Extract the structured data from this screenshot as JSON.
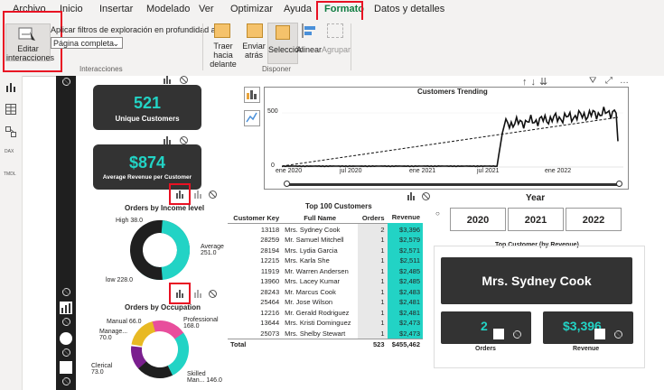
{
  "tabs": [
    "Archivo",
    "Inicio",
    "Insertar",
    "Modelado",
    "Ver",
    "Optimizar",
    "Ayuda",
    "Formato",
    "Datos y detalles"
  ],
  "ribbon": {
    "edit_interactions": "Editar interacciones",
    "drill_filters_label": "Aplicar filtros de exploración en profundidad a",
    "drill_select_value": "Página completa",
    "group_interactions": "Interacciones",
    "bring_forward": "Traer hacia delante",
    "send_backward": "Enviar atrás",
    "selection": "Selección",
    "align": "Alinear",
    "group": "Agrupar",
    "group_arrange": "Disponer"
  },
  "cards": {
    "unique_customers_value": "521",
    "unique_customers_label": "Unique Customers",
    "avg_revenue_value": "$874",
    "avg_revenue_label": "Average Revenue per Customer",
    "top_customer_title": "Top Customer (by Revenue)",
    "top_customer_name": "Mrs. Sydney Cook",
    "orders_value": "2",
    "orders_label": "Orders",
    "revenue_value": "$3,396",
    "revenue_label": "Revenue"
  },
  "trend": {
    "title": "Customers Trending",
    "yticks": [
      "500",
      "0"
    ],
    "xticks": [
      "ene 2020",
      "jul 2020",
      "ene 2021",
      "jul 2021",
      "ene 2022"
    ]
  },
  "donut_income": {
    "title": "Orders by Income level",
    "labels": [
      "High 38.0",
      "Average 251.0",
      "low 228.0"
    ]
  },
  "donut_occupation": {
    "title": "Orders by Occupation",
    "labels": [
      "Manual 66.0",
      "Manage... 70.0",
      "Professional 168.0",
      "Clerical 73.0",
      "Skilled Man... 146.0"
    ]
  },
  "table": {
    "title": "Top 100 Customers",
    "headers": [
      "Customer Key",
      "Full Name",
      "Orders",
      "Revenue"
    ],
    "rows": [
      [
        "13118",
        "Mrs. Sydney Cook",
        "2",
        "$3,396"
      ],
      [
        "28259",
        "Mr. Samuel Mitchell",
        "1",
        "$2,579"
      ],
      [
        "28194",
        "Mrs. Lydia Garcia",
        "1",
        "$2,571"
      ],
      [
        "12215",
        "Mrs. Karla She",
        "1",
        "$2,511"
      ],
      [
        "11919",
        "Mr. Warren Andersen",
        "1",
        "$2,485"
      ],
      [
        "13960",
        "Mrs. Lacey Kumar",
        "1",
        "$2,485"
      ],
      [
        "28243",
        "Mr. Marcus Cook",
        "1",
        "$2,483"
      ],
      [
        "25464",
        "Mr. Jose Wilson",
        "1",
        "$2,481"
      ],
      [
        "12216",
        "Mr. Gerald Rodriguez",
        "1",
        "$2,481"
      ],
      [
        "13644",
        "Mrs. Kristi Dominguez",
        "1",
        "$2,473"
      ],
      [
        "25073",
        "Mrs. Shelby Stewart",
        "1",
        "$2,473"
      ]
    ],
    "total_label": "Total",
    "total_orders": "523",
    "total_revenue": "$455,462"
  },
  "year_slicer": {
    "title": "Year",
    "years": [
      "2020",
      "2021",
      "2022"
    ]
  },
  "chart_data": {
    "type": "line",
    "title": "Customers Trending",
    "x": [
      "ene 2020",
      "jul 2020",
      "ene 2021",
      "jul 2021",
      "ene 2022"
    ],
    "ylim": [
      0,
      700
    ],
    "series": [
      {
        "values": [
          10,
          15,
          20,
          25,
          450,
          550,
          600
        ]
      }
    ]
  },
  "colors": {
    "accent": "#22d3c5",
    "card": "#333333",
    "highlight": "#e81123"
  }
}
